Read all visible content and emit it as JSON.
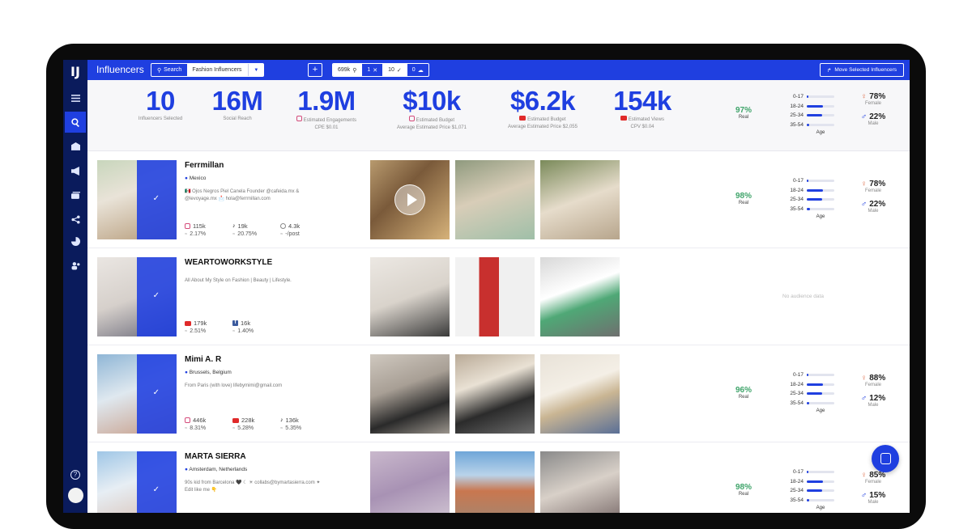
{
  "app": {
    "title": "Influencers",
    "logo": "IJ"
  },
  "sidebar": {
    "items": [
      {
        "icon": "list-icon"
      },
      {
        "icon": "search-icon",
        "active": true
      },
      {
        "icon": "inbox-icon"
      },
      {
        "icon": "megaphone-icon"
      },
      {
        "icon": "cards-icon"
      },
      {
        "icon": "share-icon"
      },
      {
        "icon": "pie-chart-icon"
      },
      {
        "icon": "users-icon"
      }
    ],
    "help": "?"
  },
  "toolbar": {
    "search_label": "Search",
    "search_value": "Fashion Influencers",
    "plus_label": "+",
    "count_reach": "699k",
    "count_selected": "1",
    "count_checked": "10",
    "count_cloud": "0",
    "move_label": "Move Selected Influencers"
  },
  "summary": {
    "metrics": [
      {
        "value": "10",
        "label": "Influencers Selected",
        "sub": ""
      },
      {
        "value": "16M",
        "label": "Social Reach",
        "sub": ""
      },
      {
        "value": "1.9M",
        "label": "Estimated Engagements",
        "sub": "CPE $0.01"
      },
      {
        "value": "$10k",
        "label": "Estimated Budget",
        "sub": "Average Estimated Price $1,071"
      },
      {
        "value": "$6.2k",
        "label": "Estimated Budget",
        "sub": "Average Estimated Price $2,055"
      },
      {
        "value": "154k",
        "label": "Estimated Views",
        "sub": "CPV $0.04"
      }
    ],
    "real_pct": "97%",
    "real_label": "Real",
    "age": {
      "buckets": [
        "0-17",
        "18-24",
        "25-34",
        "35-54"
      ],
      "fractions": [
        0.02,
        0.6,
        0.55,
        0.1
      ],
      "label": "Age"
    },
    "female_pct": "78%",
    "female_label": "Female",
    "male_pct": "22%",
    "male_label": "Male"
  },
  "influencers": [
    {
      "name": "Ferrmillan",
      "location": "Mexico",
      "bio": "🇲🇽 Ojos Negros Piel Canela Founder @cafeida.mx & @levoyage.mx 📩 hola@ferrmillan.com",
      "socials": [
        {
          "icon": "instagram-icon",
          "followers": "115k",
          "engagement": "2.17%"
        },
        {
          "icon": "tiktok-icon",
          "followers": "19k",
          "engagement": "20.75%"
        },
        {
          "icon": "website-icon",
          "followers": "4.3k",
          "engagement": "-/post"
        }
      ],
      "real_pct": "98%",
      "real_label": "Real",
      "age": {
        "fractions": [
          0.05,
          0.6,
          0.55,
          0.12
        ]
      },
      "female_pct": "78%",
      "male_pct": "22%"
    },
    {
      "name": "WEARTOWORKSTYLE",
      "location": "",
      "bio": "All About My Style on Fashion | Beauty | Lifestyle.",
      "socials": [
        {
          "icon": "youtube-icon",
          "followers": "179k",
          "engagement": "2.51%"
        },
        {
          "icon": "facebook-icon",
          "followers": "16k",
          "engagement": "1.40%"
        }
      ],
      "no_audience": "No audience data"
    },
    {
      "name": "Mimi A. R",
      "location": "Brussels, Belgium",
      "bio": "From Paris (with love) lifebymimi@gmail.com",
      "socials": [
        {
          "icon": "instagram-icon",
          "followers": "446k",
          "engagement": "8.31%"
        },
        {
          "icon": "youtube-icon",
          "followers": "228k",
          "engagement": "5.28%"
        },
        {
          "icon": "tiktok-icon",
          "followers": "136k",
          "engagement": "5.35%"
        }
      ],
      "real_pct": "96%",
      "real_label": "Real",
      "age": {
        "fractions": [
          0.05,
          0.6,
          0.55,
          0.1
        ]
      },
      "female_pct": "88%",
      "male_pct": "12%"
    },
    {
      "name": "MARTA SIERRA",
      "location": "Amsterdam, Netherlands",
      "bio": "90s kid from Barcelona 🖤 ☾ ☀ collabs@bymartasierra.com ✦ Edit like me 👇",
      "socials": [],
      "real_pct": "98%",
      "real_label": "Real",
      "age": {
        "fractions": [
          0.04,
          0.6,
          0.55,
          0.1
        ]
      },
      "female_pct": "85%",
      "male_pct": "15%"
    }
  ],
  "labels": {
    "age": "Age",
    "female": "Female",
    "male": "Male"
  }
}
